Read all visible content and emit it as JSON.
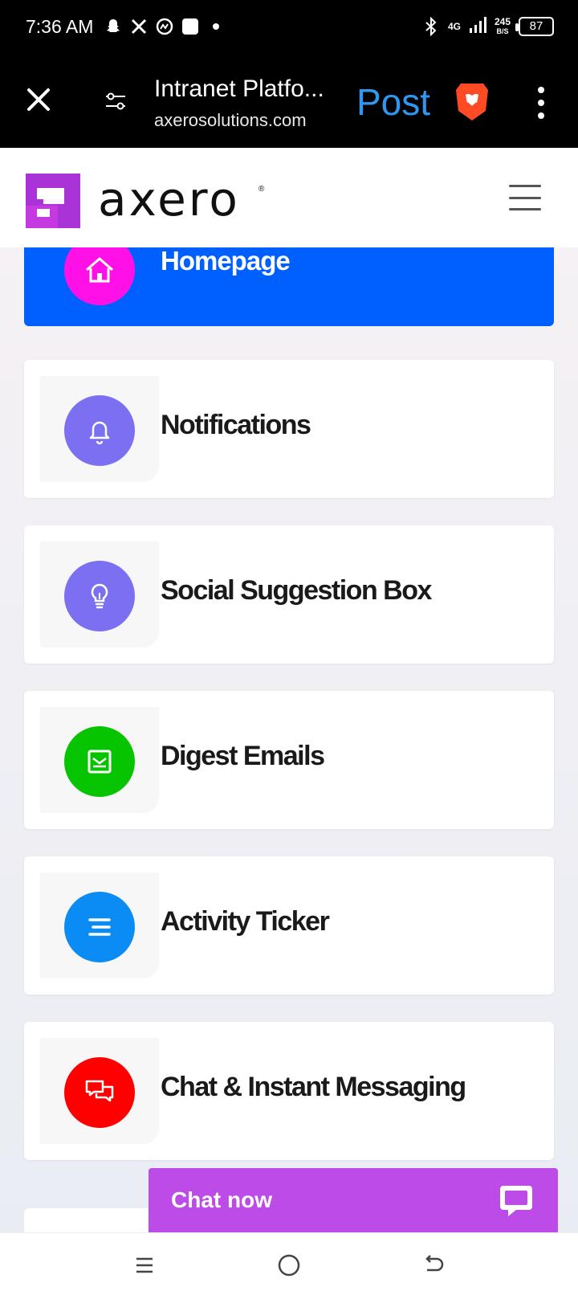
{
  "status_bar": {
    "time": "7:36 AM",
    "network": "4G",
    "speed_value": "245",
    "speed_unit": "B/S",
    "battery": "87"
  },
  "browser": {
    "title": "Intranet Platfo...",
    "url": "axerosolutions.com",
    "post_label": "Post"
  },
  "site": {
    "logo_text": "axero",
    "logo_reg": "®"
  },
  "home": {
    "label": "Homepage",
    "icon_color": "#ff10e6",
    "card_color": "#0060ff"
  },
  "features": [
    {
      "label": "Notifications",
      "icon": "bell-icon",
      "color": "#7b6ff2"
    },
    {
      "label": "Social Suggestion Box",
      "icon": "lightbulb-icon",
      "color": "#7b6ff2"
    },
    {
      "label": "Digest Emails",
      "icon": "email-icon",
      "color": "#06c400"
    },
    {
      "label": "Activity Ticker",
      "icon": "lines-icon",
      "color": "#0b8cf5"
    },
    {
      "label": "Chat & Instant Messaging",
      "icon": "chat-bubbles-icon",
      "color": "#ff0000"
    }
  ],
  "chat_now": {
    "label": "Chat now",
    "color": "#bc4be8"
  }
}
